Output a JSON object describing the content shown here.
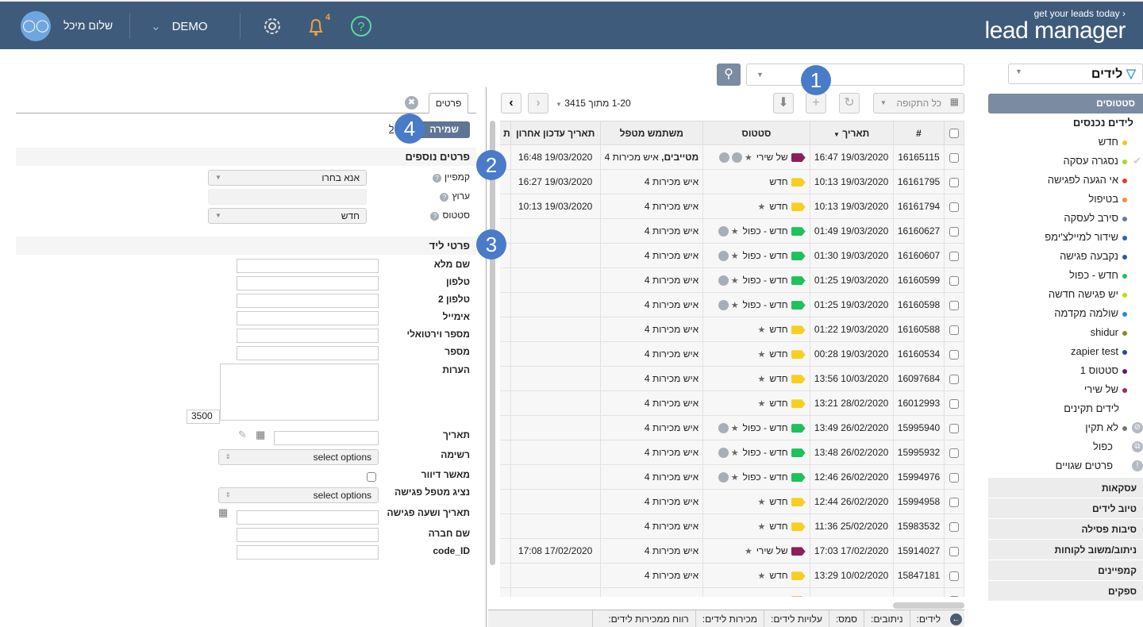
{
  "header": {
    "user_greeting": "שלום מיכל",
    "account": "DEMO",
    "notification_count": "4",
    "logo_tagline": "get your leads today ›",
    "logo_name": "lead manager"
  },
  "sidebar": {
    "filter_label": "לידים",
    "section_title": "סטטוסים",
    "subheader": "לידים נכנסים",
    "items": [
      {
        "label": "חדש",
        "color": "#f5c518"
      },
      {
        "label": "נסגרה עסקה",
        "color": "#a8d81e"
      },
      {
        "label": "אי הגעה לפגישה",
        "color": "#e8382e"
      },
      {
        "label": "בטיפול",
        "color": "#f58a3c"
      },
      {
        "label": "סירב לעסקה",
        "color": "#6b74a8"
      },
      {
        "label": "שידור למיילצ'ימפ",
        "color": "#2c63b8"
      },
      {
        "label": "נקבעה פגישה",
        "color": "#2c5aa8"
      },
      {
        "label": "חדש - כפול",
        "color": "#1ec25a"
      },
      {
        "label": "יש פגישה חדשה",
        "color": "#b8dc10"
      },
      {
        "label": "שולמה מקדמה",
        "color": "#2a8ae0"
      },
      {
        "label": "shidur",
        "color": "#8a8a20"
      },
      {
        "label": "zapier test",
        "color": "#1f4c9c"
      },
      {
        "label": "סטטוס 1",
        "color": "#5a1a80"
      },
      {
        "label": "של שירי",
        "color": "#9a2a60"
      }
    ],
    "valid_leads": "לידים תקינים",
    "invalid_items": [
      {
        "label": "לא תקין",
        "color": "#777",
        "icon": "ban-icon"
      },
      {
        "label": "כפול",
        "icon": "duplicate-icon"
      },
      {
        "label": "פרטים שגויים",
        "icon": "exclamation-icon"
      }
    ],
    "sections": [
      "עסקאות",
      "טיוב לידים",
      "סיבות פסילה",
      "ניתוב/משוב לקוחות",
      "קמפיינים",
      "ספקים"
    ]
  },
  "toolbar": {
    "period": "כל התקופה",
    "pager": "1-20 מתוך 3415"
  },
  "table": {
    "headers": [
      "#",
      "תאריך",
      "סטטוס",
      "משתמש מטפל",
      "תאריך עדכון אחרון",
      "ת"
    ],
    "rows": [
      {
        "id": "16165115",
        "date": "19/03/2020 16:47",
        "status": "של שירי",
        "color": "#8a1f5a",
        "star": true,
        "icons": 2,
        "user_bold": "מטייבים,",
        "user": "איש מכירות 4",
        "updated": "19/03/2020 16:48"
      },
      {
        "id": "16161795",
        "date": "19/03/2020 10:13",
        "status": "חדש",
        "color": "#f5d020",
        "star": false,
        "icons": 0,
        "user": "איש מכירות 4",
        "updated": "19/03/2020 16:27"
      },
      {
        "id": "16161794",
        "date": "19/03/2020 10:13",
        "status": "חדש",
        "color": "#f5d020",
        "star": true,
        "icons": 0,
        "user": "איש מכירות 4",
        "updated": "19/03/2020 10:13"
      },
      {
        "id": "16160627",
        "date": "19/03/2020 01:49",
        "status": "חדש - כפול",
        "color": "#1ec25a",
        "star": true,
        "icons": 1,
        "user": "איש מכירות 4",
        "updated": ""
      },
      {
        "id": "16160607",
        "date": "19/03/2020 01:30",
        "status": "חדש - כפול",
        "color": "#1ec25a",
        "star": true,
        "icons": 1,
        "user": "איש מכירות 4",
        "updated": ""
      },
      {
        "id": "16160599",
        "date": "19/03/2020 01:25",
        "status": "חדש - כפול",
        "color": "#1ec25a",
        "star": true,
        "icons": 1,
        "user": "איש מכירות 4",
        "updated": ""
      },
      {
        "id": "16160598",
        "date": "19/03/2020 01:25",
        "status": "חדש - כפול",
        "color": "#1ec25a",
        "star": true,
        "icons": 1,
        "user": "איש מכירות 4",
        "updated": ""
      },
      {
        "id": "16160588",
        "date": "19/03/2020 01:22",
        "status": "חדש",
        "color": "#f5d020",
        "star": true,
        "icons": 0,
        "user": "איש מכירות 4",
        "updated": ""
      },
      {
        "id": "16160534",
        "date": "19/03/2020 00:28",
        "status": "חדש",
        "color": "#f5d020",
        "star": true,
        "icons": 0,
        "user": "איש מכירות 4",
        "updated": ""
      },
      {
        "id": "16097684",
        "date": "10/03/2020 13:56",
        "status": "חדש",
        "color": "#f5d020",
        "star": true,
        "icons": 0,
        "user": "איש מכירות 4",
        "updated": ""
      },
      {
        "id": "16012993",
        "date": "28/02/2020 13:21",
        "status": "חדש",
        "color": "#f5d020",
        "star": true,
        "icons": 0,
        "user": "איש מכירות 4",
        "updated": ""
      },
      {
        "id": "15995940",
        "date": "26/02/2020 13:49",
        "status": "חדש - כפול",
        "color": "#1ec25a",
        "star": true,
        "icons": 1,
        "user": "איש מכירות 4",
        "updated": ""
      },
      {
        "id": "15995932",
        "date": "26/02/2020 13:48",
        "status": "חדש - כפול",
        "color": "#1ec25a",
        "star": true,
        "icons": 1,
        "user": "איש מכירות 4",
        "updated": ""
      },
      {
        "id": "15994976",
        "date": "26/02/2020 12:46",
        "status": "חדש - כפול",
        "color": "#1ec25a",
        "star": true,
        "icons": 1,
        "user": "איש מכירות 4",
        "updated": ""
      },
      {
        "id": "15994958",
        "date": "26/02/2020 12:44",
        "status": "חדש",
        "color": "#f5d020",
        "star": true,
        "icons": 0,
        "user": "איש מכירות 4",
        "updated": ""
      },
      {
        "id": "15983532",
        "date": "25/02/2020 11:36",
        "status": "חדש",
        "color": "#f5d020",
        "star": true,
        "icons": 0,
        "user": "איש מכירות 4",
        "updated": ""
      },
      {
        "id": "15914027",
        "date": "17/02/2020 17:03",
        "status": "של שירי",
        "color": "#8a1f5a",
        "star": true,
        "icons": 0,
        "user": "איש מכירות 4",
        "updated": "17/02/2020 17:08"
      },
      {
        "id": "15847181",
        "date": "10/02/2020 13:29",
        "status": "חדש",
        "color": "#f5d020",
        "star": true,
        "icons": 0,
        "user": "איש מכירות 4",
        "updated": ""
      },
      {
        "id": "",
        "date": "",
        "status": "",
        "color": "#f58a3c",
        "star": false,
        "icons": 0,
        "user": "",
        "updated": ""
      }
    ]
  },
  "footer": [
    "לידים:",
    "ניתובים:",
    "סמס:",
    "עלויות לידים:",
    "מכירות לידים:",
    "רווח ממכירות לידים:"
  ],
  "details": {
    "tab": "פרטים",
    "save": "שמירה",
    "save_link": "ל",
    "extra_title": "פרטים נוספים",
    "campaign_label": "קמפיין",
    "campaign_value": "אנא בחרו",
    "channel_label": "ערוץ",
    "status_label": "סטטוס",
    "status_value": "חדש",
    "lead_title": "פרטי ליד",
    "fields": [
      "שם מלא",
      "טלפון",
      "טלפון 2",
      "אימייל",
      "מספר וירטואלי",
      "מספר"
    ],
    "notes_label": "הערות",
    "notes_counter": "3500",
    "date_label": "תאריך",
    "list_label": "רשימה",
    "select_placeholder": "select options",
    "mail_label": "מאשר דיוור",
    "rep_label": "נציג מטפל פגישה",
    "meeting_label": "תאריך ושעה פגישה",
    "company_label": "שם חברה",
    "code_label": "code_ID"
  },
  "callouts": [
    "1",
    "2",
    "3",
    "4"
  ]
}
